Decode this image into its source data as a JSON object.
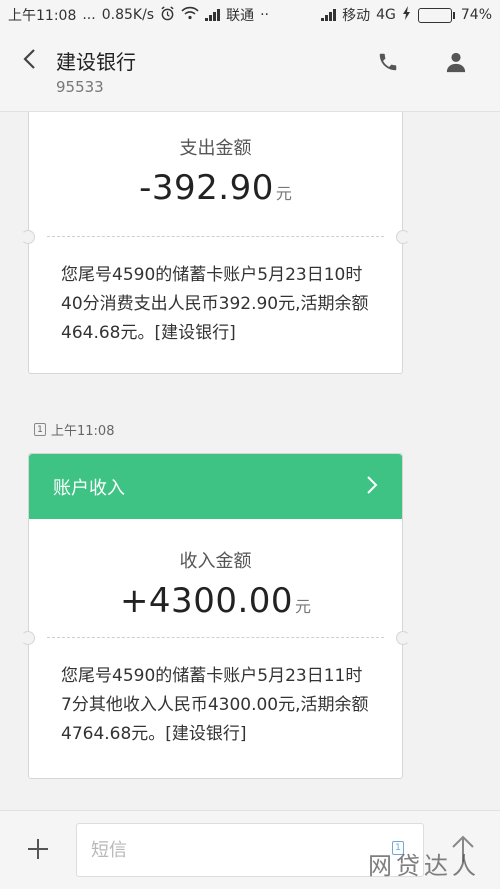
{
  "status_bar": {
    "time": "上午11:08",
    "dots": "...",
    "speed": "0.85K/s",
    "carrier1": "联通",
    "carrier1_suffix": "··",
    "carrier2": "移动",
    "network": "4G",
    "battery": "74%",
    "battery_level": 0.74
  },
  "header": {
    "title": "建设银行",
    "number": "95533",
    "back_icon": "chevron-left-icon",
    "call_icon": "phone-icon",
    "contact_icon": "person-icon"
  },
  "messages": [
    {
      "amount_label": "支出金额",
      "amount": "-392.90",
      "unit": "元",
      "text": "您尾号4590的储蓄卡账户5月23日10时40分消费支出人民币392.90元,活期余额464.68元。[建设银行]"
    },
    {
      "timestamp": "上午11:08",
      "sim": "1",
      "header_title": "账户收入",
      "amount_label": "收入金额",
      "amount": "+4300.00",
      "unit": "元",
      "text": "您尾号4590的储蓄卡账户5月23日11时7分其他收入人民币4300.00元,活期余额4764.68元。[建设银行]"
    }
  ],
  "composer": {
    "placeholder": "短信",
    "sim": "1"
  },
  "watermark": "网贷达人",
  "colors": {
    "accent_green": "#3ec384",
    "battery_green": "#55c26b"
  }
}
